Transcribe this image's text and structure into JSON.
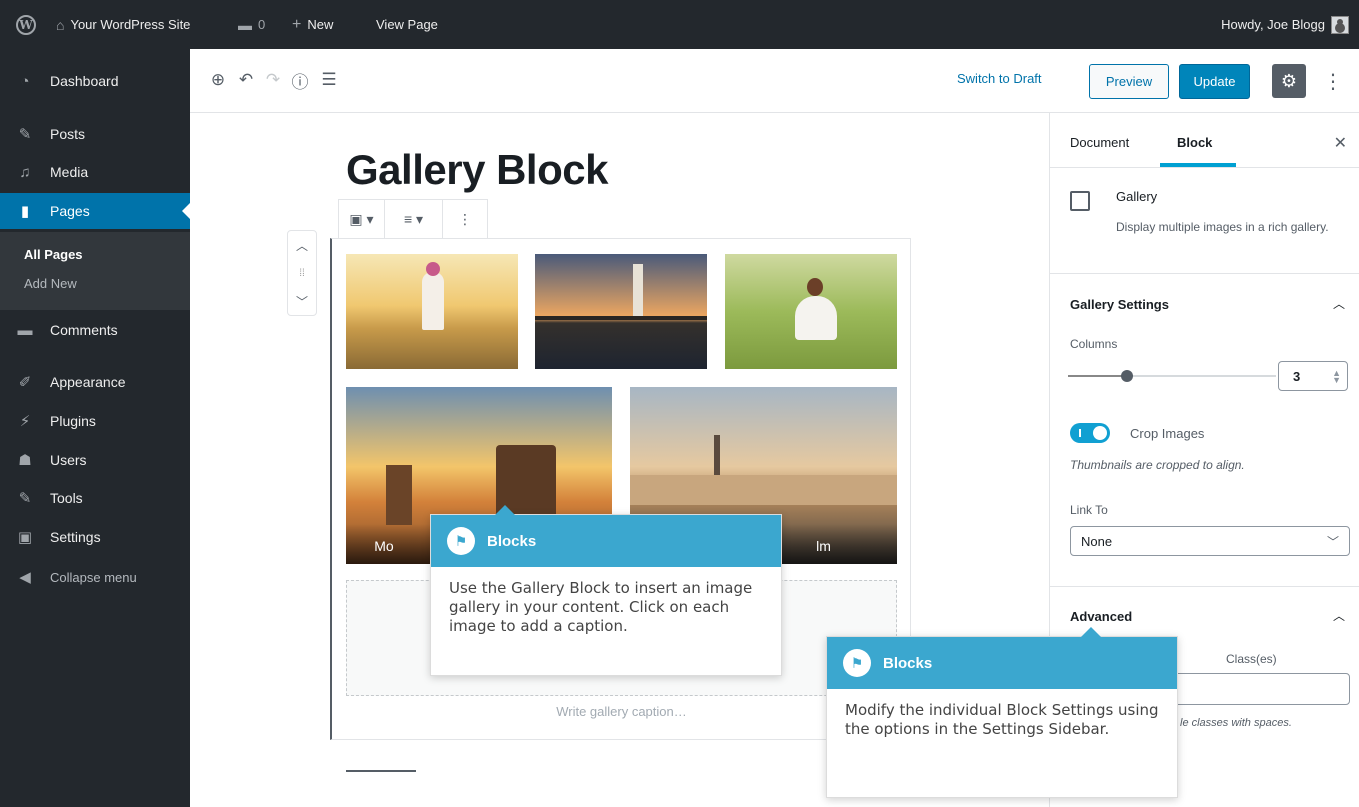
{
  "admin_bar": {
    "site_name": "Your WordPress Site",
    "comment_count": "0",
    "new_label": "New",
    "view_page_label": "View Page",
    "greeting": "Howdy, Joe Blogg"
  },
  "sidebar": {
    "items": [
      {
        "label": "Dashboard",
        "icon": "dashboard-icon"
      },
      {
        "label": "Posts",
        "icon": "pin-icon"
      },
      {
        "label": "Media",
        "icon": "media-icon"
      },
      {
        "label": "Pages",
        "icon": "page-icon"
      },
      {
        "label": "Comments",
        "icon": "comment-icon"
      },
      {
        "label": "Appearance",
        "icon": "brush-icon"
      },
      {
        "label": "Plugins",
        "icon": "plug-icon"
      },
      {
        "label": "Users",
        "icon": "users-icon"
      },
      {
        "label": "Tools",
        "icon": "wrench-icon"
      },
      {
        "label": "Settings",
        "icon": "settings-icon"
      },
      {
        "label": "Collapse menu",
        "icon": "collapse-icon"
      }
    ],
    "submenu": [
      "All Pages",
      "Add New"
    ]
  },
  "editor_header": {
    "switch_to_draft": "Switch to Draft",
    "preview": "Preview",
    "update": "Update"
  },
  "post": {
    "title": "Gallery Block",
    "gallery_caption_placeholder": "Write gallery caption…",
    "image_captions": [
      "Mo",
      "lm"
    ]
  },
  "settings_sidebar": {
    "tab_document": "Document",
    "tab_block": "Block",
    "block_name": "Gallery",
    "block_description": "Display multiple images in a rich gallery.",
    "gallery_settings_heading": "Gallery Settings",
    "columns_label": "Columns",
    "columns_value": "3",
    "columns_max": 8,
    "crop_label": "Crop Images",
    "crop_help": "Thumbnails are cropped to align.",
    "crop_enabled": true,
    "link_to_label": "Link To",
    "link_to_value": "None",
    "advanced_heading": "Advanced",
    "css_class_label_partial": "Class(es)",
    "css_help_partial": "le classes with spaces."
  },
  "popovers": [
    {
      "title": "Blocks",
      "body": "Use the Gallery Block to insert an image gallery in your content. Click on each image to add a caption."
    },
    {
      "title": "Blocks",
      "body": "Modify the individual Block Settings using the options in the Settings Sidebar."
    }
  ],
  "colors": {
    "accent": "#0073aa",
    "popover_header": "#3ba7cf",
    "admin_dark": "#23282d"
  }
}
